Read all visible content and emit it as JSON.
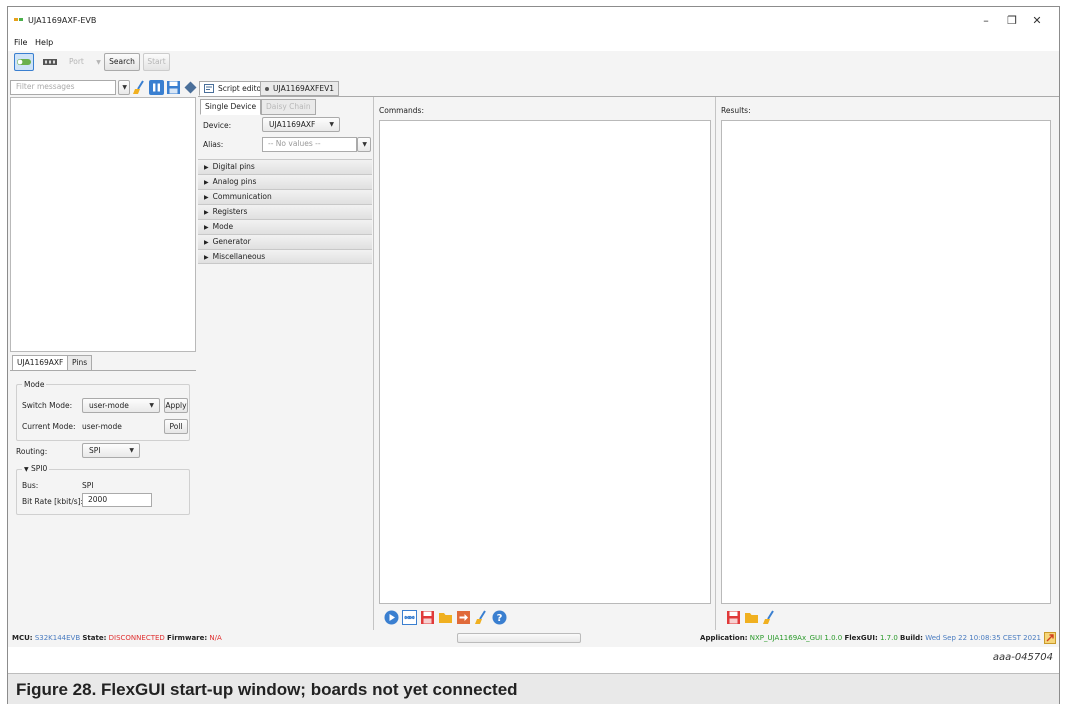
{
  "window": {
    "title": "UJA1169AXF-EVB",
    "minimize": "–",
    "maximize": "❐",
    "close": "✕"
  },
  "menu": [
    "File",
    "Help"
  ],
  "toolbar": {
    "port_label": "Port",
    "search_label": "Search",
    "start_label": "Start"
  },
  "messages": {
    "filter_placeholder": "Filter messages"
  },
  "left_tabs": {
    "device_tab": "UJA1169AXF",
    "pins_tab": "Pins"
  },
  "mode_group": {
    "title": "Mode",
    "switch_mode_label": "Switch Mode:",
    "switch_mode_value": "user-mode",
    "apply_label": "Apply",
    "current_mode_label": "Current Mode:",
    "current_mode_value": "user-mode",
    "poll_label": "Poll"
  },
  "routing": {
    "label": "Routing:",
    "value": "SPI"
  },
  "spi_group": {
    "title": "SPI0",
    "bus_label": "Bus:",
    "bus_value": "SPI",
    "bitrate_label": "Bit Rate [kbit/s]:",
    "bitrate_value": "2000"
  },
  "editor_tabs": {
    "script_editor": "Script editor",
    "device_tab": "UJA1169AXFEV1"
  },
  "device_panel": {
    "single_tab": "Single Device",
    "daisy_tab": "Daisy Chain",
    "device_label": "Device:",
    "device_value": "UJA1169AXF",
    "alias_label": "Alias:",
    "alias_placeholder": "-- No values --"
  },
  "accordion": [
    "Digital pins",
    "Analog pins",
    "Communication",
    "Registers",
    "Mode",
    "Generator",
    "Miscellaneous"
  ],
  "commands": {
    "label": "Commands:"
  },
  "results": {
    "label": "Results:"
  },
  "status": {
    "mcu_label": "MCU:",
    "mcu_value": "S32K144EVB",
    "state_label": "State:",
    "state_value": "DISCONNECTED",
    "firmware_label": "Firmware:",
    "firmware_value": "N/A",
    "application_label": "Application:",
    "application_value": "NXP_UJA1169Ax_GUI 1.0.0",
    "flexgui_label": "FlexGUI:",
    "flexgui_value": "1.7.0",
    "build_label": "Build:",
    "build_value": "Wed Sep 22 10:08:35 CEST 2021"
  },
  "figure": {
    "id": "aaa-045704",
    "caption": "Figure 28.  FlexGUI start-up window; boards not yet connected"
  },
  "colors": {
    "accent": "#3a7fd0",
    "error": "#e03030",
    "ok": "#2a9a2a"
  }
}
